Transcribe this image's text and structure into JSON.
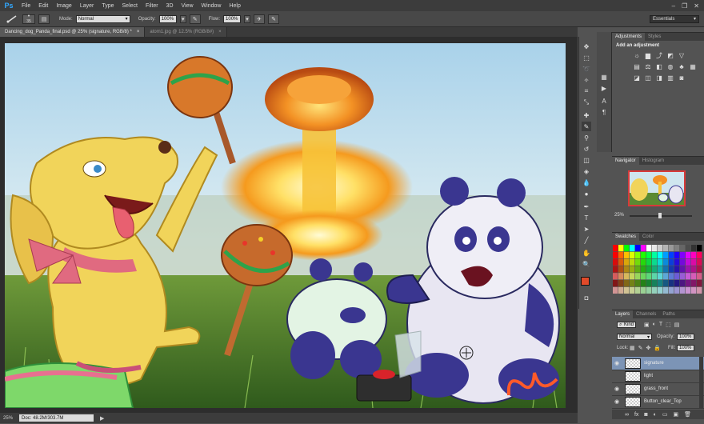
{
  "app": {
    "logo": "Ps"
  },
  "menu": [
    "File",
    "Edit",
    "Image",
    "Layer",
    "Type",
    "Select",
    "Filter",
    "3D",
    "View",
    "Window",
    "Help"
  ],
  "window_controls": {
    "minimize": "–",
    "restore": "❐",
    "close": "✕"
  },
  "options": {
    "mode_label": "Mode:",
    "mode_value": "Normal",
    "opacity_label": "Opacity:",
    "opacity_value": "100%",
    "flow_label": "Flow:",
    "flow_value": "100%",
    "brush_size": "35",
    "workspace": "Essentials"
  },
  "tabs": [
    {
      "label": "Dancing_dog_Panda_final.psd @ 25% (signature, RGB/8) *",
      "close": "×"
    },
    {
      "label": "atom1.jpg @ 12.5% (RGB/8#)",
      "close": "×"
    }
  ],
  "status": {
    "zoom": "25%",
    "doc_size": "Doc: 48.2M/303.7M"
  },
  "panels": {
    "adjustments": {
      "tabs": [
        "Adjustments",
        "Styles"
      ],
      "title": "Add an adjustment"
    },
    "navigator": {
      "tabs": [
        "Navigator",
        "Histogram"
      ],
      "zoom": "25%"
    },
    "swatches": {
      "tabs": [
        "Swatches",
        "Color"
      ]
    },
    "layers": {
      "tabs": [
        "Layers",
        "Channels",
        "Paths"
      ],
      "filter": "Kind",
      "blend": "Normal",
      "opacity_label": "Opacity:",
      "opacity_value": "100%",
      "lock_label": "Lock:",
      "fill_label": "Fill:",
      "fill_value": "100%",
      "items": [
        {
          "name": "signature"
        },
        {
          "name": "light"
        },
        {
          "name": "grass_front"
        },
        {
          "name": "Button_clear_Top"
        }
      ]
    }
  },
  "colors": {
    "accent_red": "#d83a3a",
    "selection": "#7c94b6"
  }
}
